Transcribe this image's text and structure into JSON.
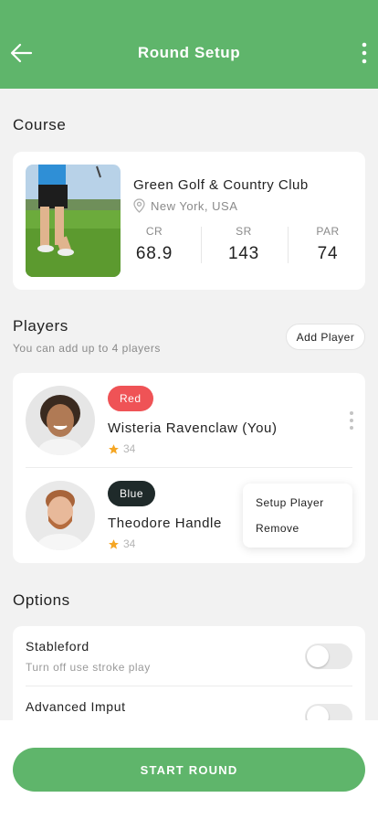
{
  "header": {
    "title": "Round Setup",
    "back_icon": "arrow-left-icon",
    "more_icon": "more-vertical-icon"
  },
  "course": {
    "section_title": "Course",
    "name": "Green Golf & Country Club",
    "location": "New York, USA",
    "stats": [
      {
        "label": "CR",
        "value": "68.9"
      },
      {
        "label": "SR",
        "value": "143"
      },
      {
        "label": "PAR",
        "value": "74"
      }
    ]
  },
  "players": {
    "section_title": "Players",
    "subtitle": "You can add up to 4 players",
    "add_label": "Add Player",
    "items": [
      {
        "tee": "Red",
        "tee_color": "#ef5356",
        "name": "Wisteria Ravenclaw (You)",
        "rating": "34"
      },
      {
        "tee": "Blue",
        "tee_color": "#1f2a2a",
        "name": "Theodore Handle",
        "rating": "34"
      }
    ],
    "menu": {
      "setup": "Setup Player",
      "remove": "Remove"
    }
  },
  "options": {
    "section_title": "Options",
    "items": [
      {
        "title": "Stableford",
        "subtitle": "Turn off use stroke play",
        "enabled": false
      },
      {
        "title": "Advanced Imput",
        "enabled": false
      }
    ]
  },
  "footer": {
    "start_label": "START ROUND"
  },
  "colors": {
    "accent": "#5fb56b",
    "star": "#f5a623"
  }
}
